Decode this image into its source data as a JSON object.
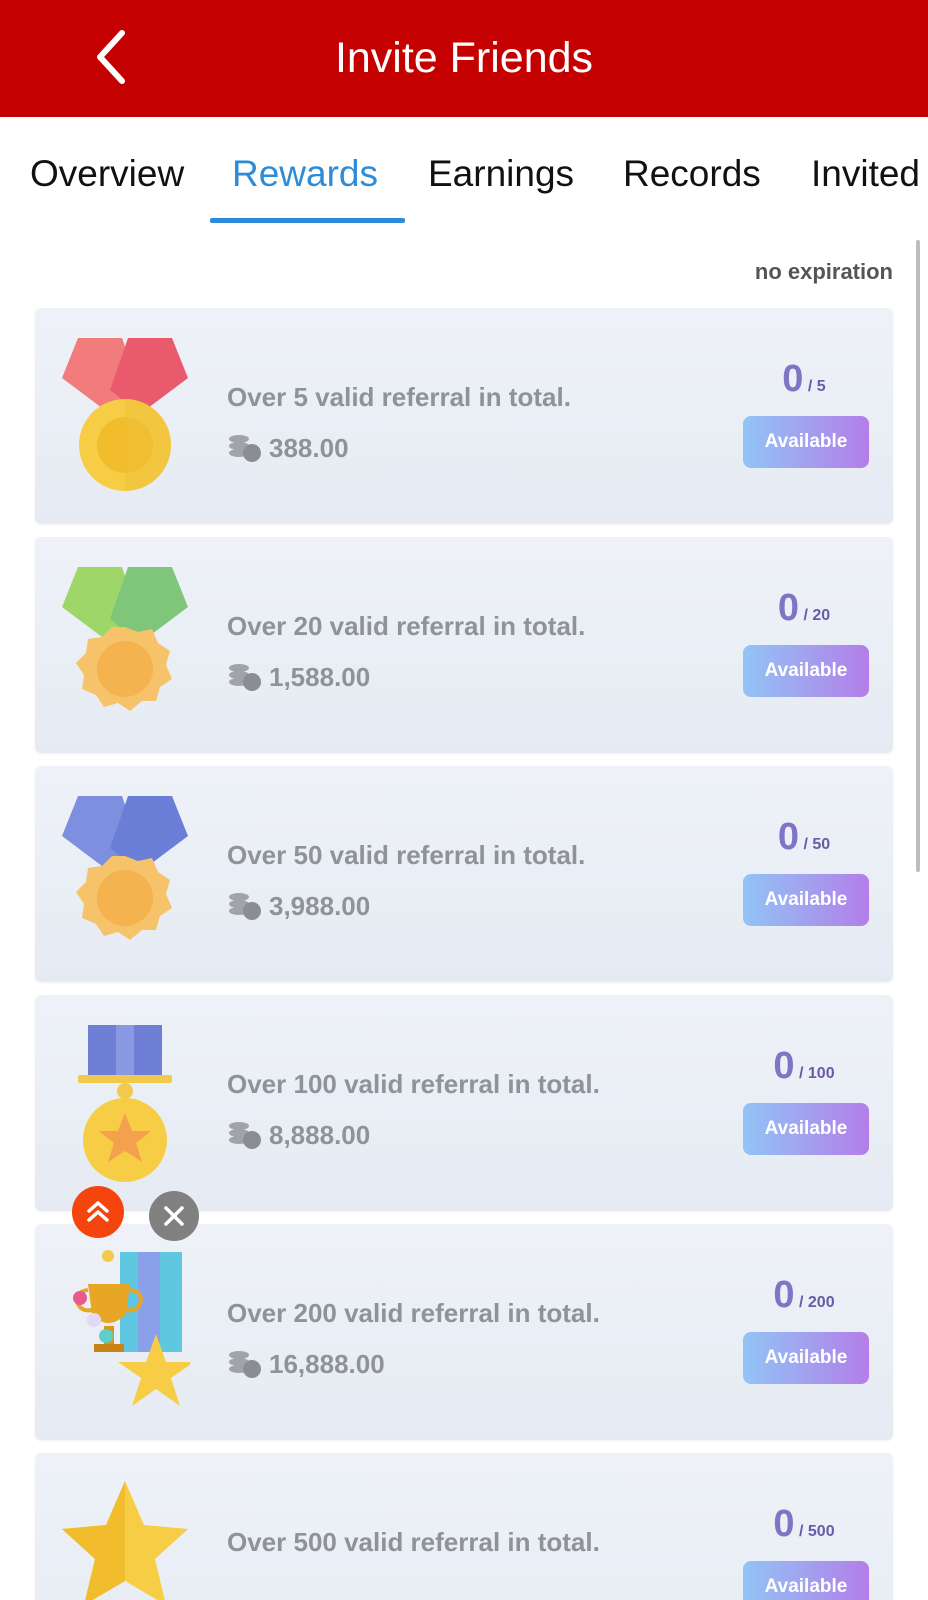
{
  "header": {
    "title": "Invite Friends",
    "back_icon": "chevron-left-icon"
  },
  "tabs": [
    {
      "label": "Overview",
      "active": false
    },
    {
      "label": "Rewards",
      "active": true
    },
    {
      "label": "Earnings",
      "active": false
    },
    {
      "label": "Records",
      "active": false
    },
    {
      "label": "Invited",
      "active": false
    }
  ],
  "colors": {
    "header_bg": "#c40000",
    "tab_active": "#2e8bd8",
    "progress": "#8174c4"
  },
  "expiry_text": "no expiration",
  "rewards": [
    {
      "description": "Over 5 valid referral in total.",
      "amount": "388.00",
      "count": "0",
      "total": "5",
      "button": "Available",
      "medal_icon": "red-ribbon-gold-medal-icon"
    },
    {
      "description": "Over 20 valid referral in total.",
      "amount": "1,588.00",
      "count": "0",
      "total": "20",
      "button": "Available",
      "medal_icon": "green-ribbon-orange-medal-icon"
    },
    {
      "description": "Over 50 valid referral in total.",
      "amount": "3,988.00",
      "count": "0",
      "total": "50",
      "button": "Available",
      "medal_icon": "blue-ribbon-orange-medal-icon"
    },
    {
      "description": "Over 100 valid referral in total.",
      "amount": "8,888.00",
      "count": "0",
      "total": "100",
      "button": "Available",
      "medal_icon": "star-medal-icon"
    },
    {
      "description": "Over 200 valid referral in total.",
      "amount": "16,888.00",
      "count": "0",
      "total": "200",
      "button": "Available",
      "medal_icon": "trophy-star-ribbon-icon"
    },
    {
      "description": "Over 500 valid referral in total.",
      "amount": "",
      "count": "0",
      "total": "500",
      "button": "Available",
      "medal_icon": "gold-star-icon"
    }
  ],
  "floating": {
    "scroll_top_icon": "double-chevron-up-icon",
    "close_icon": "close-icon"
  }
}
